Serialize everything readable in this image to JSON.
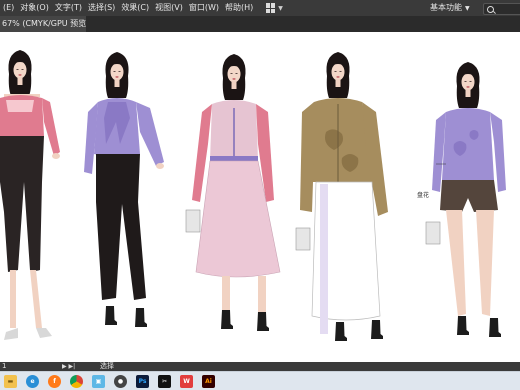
{
  "menubar": {
    "items": [
      "(E)",
      "对象(O)",
      "文字(T)",
      "选择(S)",
      "效果(C)",
      "视图(V)",
      "窗口(W)",
      "帮助(H)"
    ],
    "workspace_label": "基本功能"
  },
  "document_tab": {
    "label": "67% (CMYK/GPU 预览)"
  },
  "canvas": {
    "annotation": "盘花"
  },
  "statusbar": {
    "page_number": "1",
    "tool_name": "选择"
  },
  "taskbar": {
    "apps": [
      "file-explorer",
      "edge",
      "firefox",
      "chrome",
      "gallery",
      "media",
      "photoshop",
      "capcut",
      "wps",
      "illustrator"
    ]
  },
  "colors": {
    "menubar_bg": "#3a3a3a",
    "canvas_bg": "#ffffff",
    "taskbar_bg": "#dfe6ee",
    "pink_knit": "#e07b8f",
    "lavender": "#9e8fd3",
    "khaki_cardigan": "#a68d5e",
    "pale_pink_skirt": "#ecc8d6",
    "black_pants": "#2a2424"
  }
}
